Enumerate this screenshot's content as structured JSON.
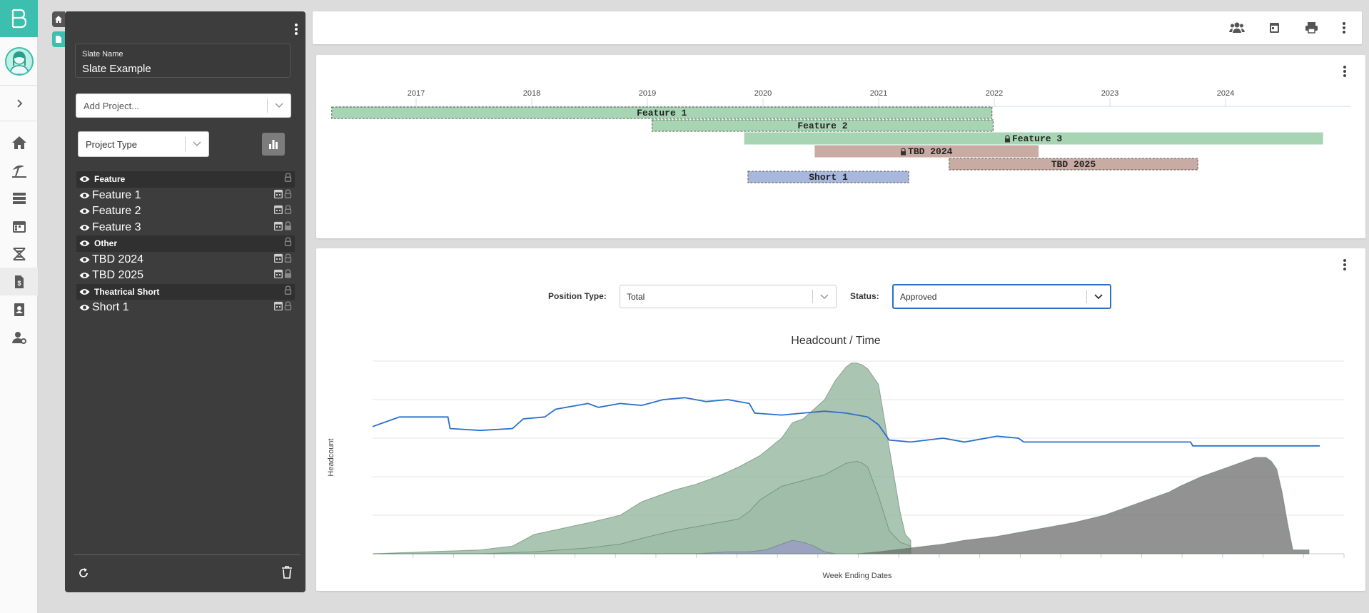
{
  "slate": {
    "name_label": "Slate Name",
    "name_value": "Slate Example",
    "add_project_placeholder": "Add Project...",
    "group_by_value": "Project Type"
  },
  "tree": [
    {
      "kind": "group",
      "label": "Feature",
      "locked": false
    },
    {
      "kind": "project",
      "label": "Feature 1",
      "locked": false
    },
    {
      "kind": "project",
      "label": "Feature 2",
      "locked": false
    },
    {
      "kind": "project",
      "label": "Feature 3",
      "locked": true
    },
    {
      "kind": "group",
      "label": "Other",
      "locked": false
    },
    {
      "kind": "project",
      "label": "TBD 2024",
      "locked": false
    },
    {
      "kind": "project",
      "label": "TBD 2025",
      "locked": true
    },
    {
      "kind": "group",
      "label": "Theatrical Short",
      "locked": false
    },
    {
      "kind": "project",
      "label": "Short 1",
      "locked": false
    }
  ],
  "timeline": {
    "years": [
      "2017",
      "2018",
      "2019",
      "2020",
      "2021",
      "2022",
      "2023",
      "2024"
    ],
    "bars": [
      {
        "label": "Feature 1",
        "start": 2016.27,
        "end": 2021.98,
        "color": "#a7d5b3",
        "dashed": true,
        "locked": false
      },
      {
        "label": "Feature 2",
        "start": 2019.04,
        "end": 2021.99,
        "color": "#a7d5b3",
        "dashed": true,
        "locked": false
      },
      {
        "label": "Feature 3",
        "start": 2019.84,
        "end": 2024.84,
        "color": "#a7d5b3",
        "dashed": false,
        "locked": true
      },
      {
        "label": "TBD 2024",
        "start": 2020.45,
        "end": 2022.38,
        "color": "#c8aba3",
        "dashed": false,
        "locked": true
      },
      {
        "label": "TBD 2025",
        "start": 2021.61,
        "end": 2023.76,
        "color": "#c8aba3",
        "dashed": true,
        "locked": false
      },
      {
        "label": "Short 1",
        "start": 2019.87,
        "end": 2021.26,
        "color": "#a8b8dc",
        "dashed": true,
        "locked": false
      }
    ]
  },
  "filters": {
    "position_type_label": "Position Type:",
    "position_type_value": "Total",
    "status_label": "Status:",
    "status_value": "Approved"
  },
  "chart_data": {
    "type": "area",
    "title": "Headcount / Time",
    "xlabel": "Week Ending Dates",
    "ylabel": "Headcount",
    "ylim": [
      0,
      100
    ],
    "grid": true,
    "series": [
      {
        "name": "",
        "color": "#2a6fc9",
        "style": "line",
        "x": [
          2016.0,
          2016.1,
          2016.25,
          2016.5,
          2016.7,
          2016.72,
          2017.0,
          2017.3,
          2017.4,
          2017.6,
          2017.7,
          2017.8,
          2017.9,
          2018.0,
          2018.1,
          2018.3,
          2018.5,
          2018.7,
          2018.9,
          2019.1,
          2019.3,
          2019.5,
          2019.55,
          2019.8,
          2020.0,
          2020.2,
          2020.4,
          2020.6,
          2020.7,
          2020.75,
          2020.8,
          2021.0,
          2021.3,
          2021.5,
          2021.8,
          2022.0,
          2022.05,
          2022.5,
          2023.0,
          2023.6,
          2023.62,
          2024.0,
          2024.5,
          2024.8
        ],
        "y": [
          66,
          68,
          71,
          71,
          71,
          65,
          64,
          65,
          70,
          71,
          75,
          76,
          77,
          78,
          76,
          78,
          77,
          80,
          81,
          79,
          80,
          78,
          73,
          72,
          73,
          74,
          73,
          71,
          67,
          63,
          59,
          58,
          60,
          58,
          61,
          60,
          58,
          58,
          58,
          58,
          56,
          56,
          56,
          56
        ]
      },
      {
        "name": "",
        "color": "#8fb19a",
        "style": "area",
        "x": [
          2016.0,
          2016.5,
          2017.0,
          2017.3,
          2017.5,
          2018.0,
          2018.3,
          2018.5,
          2018.8,
          2019.0,
          2019.2,
          2019.4,
          2019.5,
          2019.6,
          2019.8,
          2019.9,
          2020.0,
          2020.1,
          2020.2,
          2020.3,
          2020.4,
          2020.45,
          2020.5,
          2020.55,
          2020.6,
          2020.7,
          2020.8,
          2020.9,
          2020.95,
          2021.0
        ],
        "y": [
          0,
          1,
          2,
          4,
          10,
          16,
          20,
          27,
          33,
          36,
          40,
          45,
          48,
          51,
          60,
          68,
          70,
          75,
          80,
          90,
          97,
          99,
          99,
          98,
          96,
          88,
          55,
          22,
          10,
          7
        ]
      },
      {
        "name": "",
        "color": "#9bb9a4",
        "style": "area",
        "x": [
          2016.0,
          2016.5,
          2017.0,
          2017.5,
          2018.0,
          2018.3,
          2018.5,
          2018.8,
          2019.0,
          2019.2,
          2019.4,
          2019.5,
          2019.6,
          2019.8,
          2020.0,
          2020.2,
          2020.3,
          2020.4,
          2020.5,
          2020.55,
          2020.6,
          2020.7,
          2020.8,
          2020.9,
          2021.0
        ],
        "y": [
          0,
          0,
          0,
          1,
          3,
          5,
          8,
          12,
          14,
          16,
          18,
          22,
          28,
          35,
          38,
          41,
          44,
          47,
          48,
          47,
          45,
          30,
          12,
          6,
          4
        ]
      },
      {
        "name": "",
        "color": "#9a9ac8",
        "style": "area",
        "x": [
          2018.5,
          2018.8,
          2019.0,
          2019.3,
          2019.5,
          2019.65,
          2019.8,
          2019.9,
          2020.0,
          2020.1,
          2020.2,
          2020.3
        ],
        "y": [
          0,
          0,
          0,
          1,
          1,
          2,
          5,
          7,
          6,
          4,
          1,
          0
        ]
      },
      {
        "name": "",
        "color": "#6e6e6e",
        "style": "area",
        "x": [
          2020.5,
          2020.7,
          2021.0,
          2021.3,
          2021.5,
          2021.8,
          2022.0,
          2022.3,
          2022.5,
          2022.8,
          2023.0,
          2023.2,
          2023.4,
          2023.5,
          2023.7,
          2023.8,
          2023.9,
          2024.0,
          2024.1,
          2024.2,
          2024.3,
          2024.35,
          2024.4,
          2024.45,
          2024.5,
          2024.55,
          2024.7
        ],
        "y": [
          0,
          1,
          3,
          5,
          7,
          9,
          11,
          14,
          16,
          20,
          24,
          28,
          32,
          35,
          40,
          42,
          44,
          46,
          48,
          50,
          50,
          48,
          44,
          32,
          16,
          2,
          2
        ]
      }
    ]
  }
}
